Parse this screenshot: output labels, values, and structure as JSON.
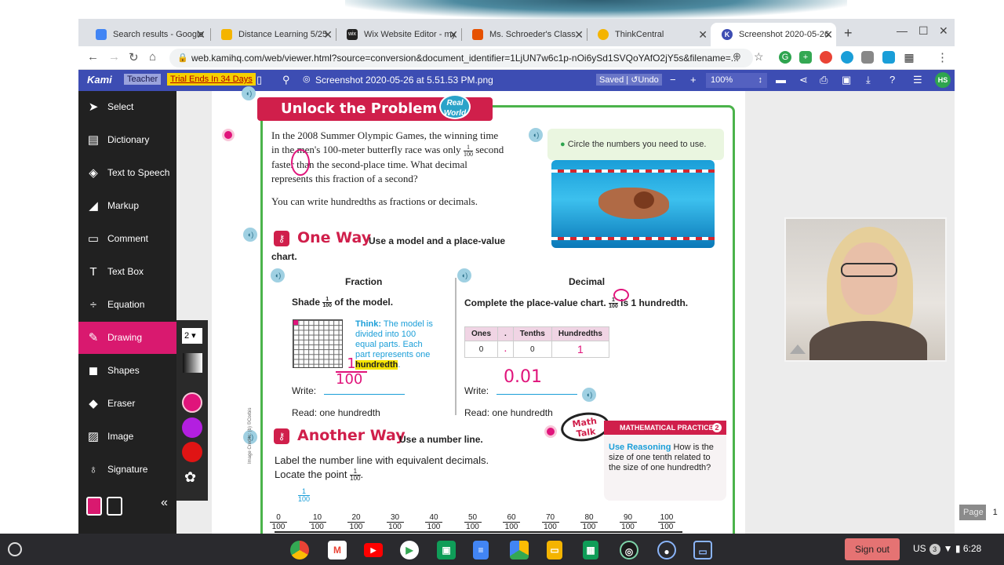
{
  "tabs": [
    {
      "title": "Search results - Google",
      "favicon_color": "#4285f4"
    },
    {
      "title": "Distance Learning 5/25",
      "favicon_color": "#f4b400"
    },
    {
      "title": "Wix Website Editor - my",
      "favicon_color": "#222222"
    },
    {
      "title": "Ms. Schroeder's Class",
      "favicon_color": "#e65100"
    },
    {
      "title": "ThinkCentral",
      "favicon_color": "#f4b400"
    },
    {
      "title": "Screenshot 2020-05-26",
      "favicon_color": "#3d4db3"
    }
  ],
  "address": {
    "url": "web.kamihq.com/web/viewer.html?source=conversion&document_identifier=1LjUN7w6c1p-nOi6ySd1SVQoYAfO2jY5s&filename=..."
  },
  "kami": {
    "logo": "Kami",
    "role": "Teacher",
    "trial": "Trial Ends In 34 Days",
    "document_name": "Screenshot 2020-05-26 at 5.51.53 PM.png",
    "saved": "Saved",
    "undo": "Undo",
    "zoom": "100%",
    "user_initials": "HS",
    "accent": "#3d4db3"
  },
  "sidebar": {
    "items": [
      {
        "label": "Select",
        "icon": "cursor-icon"
      },
      {
        "label": "Dictionary",
        "icon": "book-icon"
      },
      {
        "label": "Text to Speech",
        "icon": "speaker-icon"
      },
      {
        "label": "Markup",
        "icon": "markup-icon"
      },
      {
        "label": "Comment",
        "icon": "comment-icon"
      },
      {
        "label": "Text Box",
        "icon": "textbox-icon"
      },
      {
        "label": "Equation",
        "icon": "equation-icon"
      },
      {
        "label": "Drawing",
        "icon": "brush-icon"
      },
      {
        "label": "Shapes",
        "icon": "shapes-icon"
      },
      {
        "label": "Eraser",
        "icon": "eraser-icon"
      },
      {
        "label": "Image",
        "icon": "image-icon"
      },
      {
        "label": "Signature",
        "icon": "signature-icon"
      }
    ],
    "active": "Drawing",
    "active_color": "#d9196f"
  },
  "drawing_panel": {
    "size": "2",
    "colors": [
      "#e0147b",
      "#b31fe0",
      "#e01414"
    ]
  },
  "worksheet": {
    "banner": "Unlock the Problem",
    "badge_line1": "Real",
    "badge_line2": "World",
    "problem_pre": "In the 2008 Summer Olympic Games, the winning time in the men's 100-meter butterfly race was only",
    "problem_frac_num": "1",
    "problem_frac_den": "100",
    "problem_post": "second faster than the second-place time. What decimal represents this fraction of a second?",
    "write_hundredths": "You can write hundredths as fractions or decimals.",
    "circle_note": "Circle the numbers you need to use.",
    "one_way_title": "One Way",
    "one_way_sub": "Use a model and a place-value",
    "one_way_sub2": "chart.",
    "fraction_head": "Fraction",
    "decimal_head": "Decimal",
    "shade_pre": "Shade",
    "shade_post": "of the model.",
    "think_label": "Think:",
    "think_text": "The model is divided into 100 equal parts. Each part represents one",
    "think_hl": "hundredth",
    "complete_pre": "Complete the place-value chart.",
    "complete_post": "is 1 hundredth.",
    "pv_headers": [
      "Ones",
      ".",
      "Tenths",
      "Hundredths"
    ],
    "pv_values": [
      "0",
      ".",
      "0",
      ""
    ],
    "write_label": "Write:",
    "read_label": "Read: one hundredth",
    "another_title": "Another Way",
    "another_sub": "Use a number line.",
    "label_line": "Label the number line with equivalent decimals.",
    "locate_pre": "Locate the point",
    "math_talk_1": "Math",
    "math_talk_2": "Talk",
    "mp_head": "MATHEMATICAL PRACTICES",
    "mp_num": "2",
    "mp_bold": "Use Reasoning",
    "mp_text": "How is the size of one tenth related to the size of one hundredth?",
    "numline_top": [
      "0",
      "10",
      "20",
      "30",
      "40",
      "50",
      "60",
      "70",
      "80",
      "90",
      "100"
    ],
    "numline_den": "100",
    "numline_extra_num": "1",
    "copyright": "Image Credits: (b) ©Corbis"
  },
  "handwriting": {
    "frac_num": "1",
    "frac_den": "100",
    "decimal": "0.01",
    "pv_hundredths": "1",
    "pv_point": "."
  },
  "page_indicator": {
    "label": "Page",
    "current": "1",
    "total": "/ 1"
  },
  "shelf": {
    "signout": "Sign out",
    "locale": "US",
    "notif_count": "3",
    "time": "6:28"
  }
}
